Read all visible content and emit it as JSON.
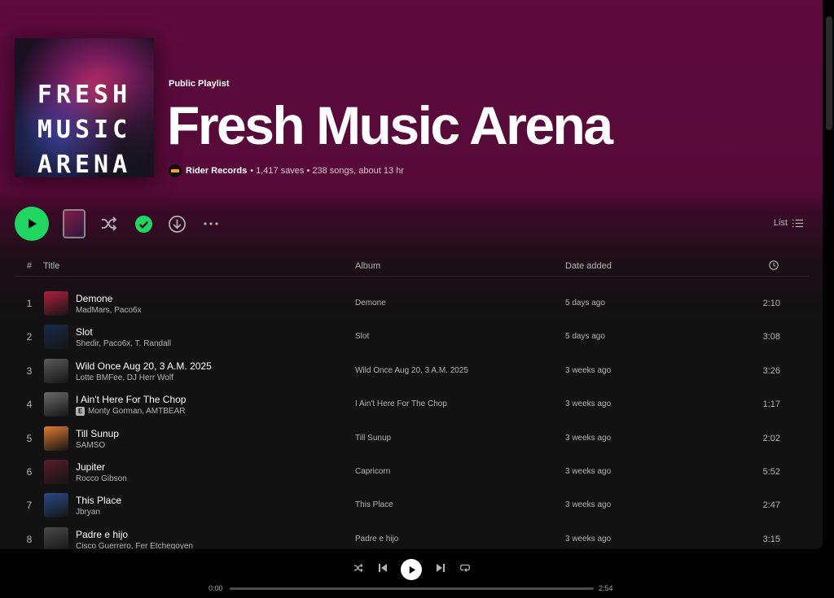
{
  "header": {
    "playlist_type": "Public Playlist",
    "title": "Fresh Music Arena",
    "cover_text": "FRESH\nMUSIC\nARENA",
    "owner": "Rider Records",
    "stats": "• 1,417 saves • 238 songs, about 13 hr"
  },
  "actions": {
    "list_label": "List",
    "icons": [
      "play-icon",
      "shuffle-icon",
      "saved-check-icon",
      "download-icon",
      "more-icon",
      "list-icon"
    ]
  },
  "table": {
    "headers": {
      "num": "#",
      "title": "Title",
      "album": "Album",
      "date_added": "Date added",
      "duration_icon": "clock-icon"
    },
    "rows": [
      {
        "num": "1",
        "title": "Demone",
        "artist": "MadMars, Paco6x",
        "explicit": false,
        "album": "Demone",
        "date_added": "5 days ago",
        "duration": "2:10",
        "color": "#b02040"
      },
      {
        "num": "2",
        "title": "Slot",
        "artist": "Shedir, Paco6x, T. Randall",
        "explicit": false,
        "album": "Slot",
        "date_added": "5 days ago",
        "duration": "3:08",
        "color": "#1a2a4a"
      },
      {
        "num": "3",
        "title": "Wild Once Aug 20, 3 A.M. 2025",
        "artist": "Lotte BMFee, DJ Herr Wolf",
        "explicit": false,
        "album": "Wild Once Aug 20, 3 A.M. 2025",
        "date_added": "3 weeks ago",
        "duration": "3:26",
        "color": "#5a5a5a"
      },
      {
        "num": "4",
        "title": "I Ain't Here For The Chop",
        "artist": "Monty Gorman, AMTBEAR",
        "explicit": true,
        "explicit_label": "E",
        "album": "I Ain't Here For The Chop",
        "date_added": "3 weeks ago",
        "duration": "1:17",
        "color": "#6a6a6a"
      },
      {
        "num": "5",
        "title": "Till Sunup",
        "artist": "SAMSO",
        "explicit": false,
        "album": "Till Sunup",
        "date_added": "3 weeks ago",
        "duration": "2:02",
        "color": "#e07a30"
      },
      {
        "num": "6",
        "title": "Jupiter",
        "artist": "Rocco Gibson",
        "explicit": false,
        "album": "Capricorn",
        "date_added": "3 weeks ago",
        "duration": "5:52",
        "color": "#5a1a2a"
      },
      {
        "num": "7",
        "title": "This Place",
        "artist": "Jbryan",
        "explicit": false,
        "album": "This Place",
        "date_added": "3 weeks ago",
        "duration": "2:47",
        "color": "#2a4a8a"
      },
      {
        "num": "8",
        "title": "Padre e hijo",
        "artist": "Cisco Guerrero, Fer Etchegoyen",
        "explicit": false,
        "album": "Padre e hijo",
        "date_added": "3 weeks ago",
        "duration": "3:15",
        "color": "#4a4a4a"
      }
    ]
  },
  "player": {
    "current_time": "0:00",
    "total_time": "2:54",
    "progress": 0
  },
  "colors": {
    "accent": "#1ed760",
    "header_bg": "#5d0a3c",
    "body_bg": "#121212"
  }
}
